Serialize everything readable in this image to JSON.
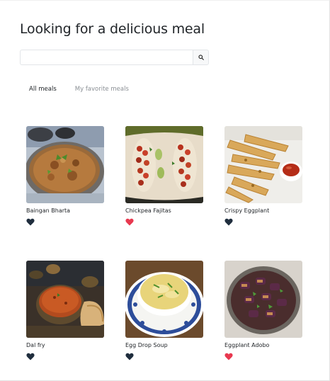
{
  "page": {
    "title": "Looking for a delicious meal"
  },
  "search": {
    "value": "",
    "placeholder": "",
    "icon": "search-icon"
  },
  "tabs": [
    {
      "label": "All meals",
      "active": true
    },
    {
      "label": "My favorite meals",
      "active": false
    }
  ],
  "colors": {
    "heart_favorite": "#e8384f",
    "heart_default": "#1f2d3d",
    "text": "#212529",
    "muted": "#8a8f94"
  },
  "meals": [
    {
      "name": "Baingan Bharta",
      "favorite": false
    },
    {
      "name": "Chickpea Fajitas",
      "favorite": true
    },
    {
      "name": "Crispy Eggplant",
      "favorite": false
    },
    {
      "name": "Dal fry",
      "favorite": false
    },
    {
      "name": "Egg Drop Soup",
      "favorite": false
    },
    {
      "name": "Eggplant Adobo",
      "favorite": true
    }
  ]
}
